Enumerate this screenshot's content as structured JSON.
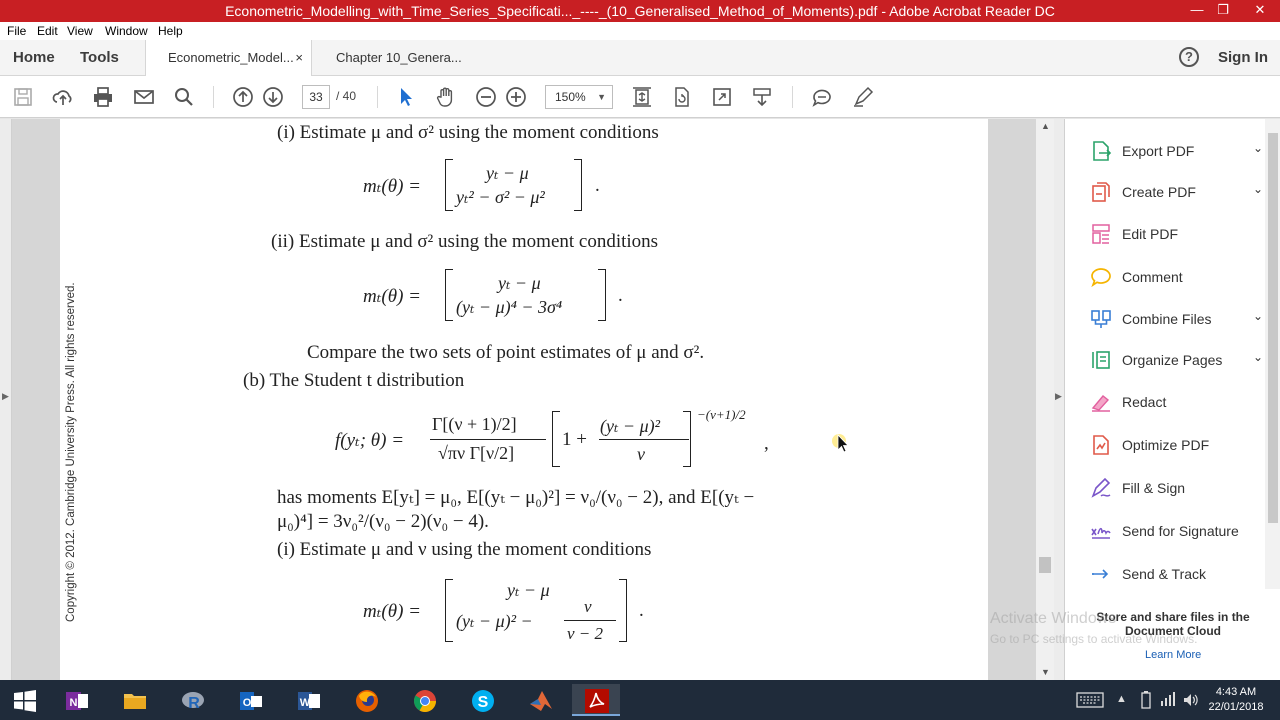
{
  "window": {
    "title": "Econometric_Modelling_with_Time_Series_Specificati..._----_(10_Generalised_Method_of_Moments).pdf - Adobe Acrobat Reader DC",
    "minimize": "—",
    "maximize": "❐",
    "close": "✕"
  },
  "menu": [
    "File",
    "Edit",
    "View",
    "Window",
    "Help"
  ],
  "nav": {
    "home": "Home",
    "tools": "Tools",
    "sign_in": "Sign In",
    "help": "?"
  },
  "tabs": [
    {
      "label": "Econometric_Model...",
      "close": "×"
    },
    {
      "label": "Chapter 10_Genera..."
    }
  ],
  "toolbar": {
    "page_current": "33",
    "page_total": "/  40",
    "zoom": "150%",
    "zoom_caret": "▼"
  },
  "document": {
    "copyright": "Copyright © 2012. Cambridge University Press. All rights reserved.",
    "lines": {
      "l1": "(i)  Estimate μ and σ² using the moment conditions",
      "eq1_lhs": "mₜ(θ) =",
      "eq1_top": "yₜ − μ",
      "eq1_bot": "yₜ² − σ² − μ²",
      "eq1_end": ".",
      "l2": "(ii)  Estimate μ and σ² using the moment conditions",
      "eq2_lhs": "mₜ(θ) =",
      "eq2_top": "yₜ − μ",
      "eq2_bot": "(yₜ − μ)⁴ − 3σ⁴",
      "eq2_end": ".",
      "l3": "Compare the two sets of point estimates of μ and σ².",
      "l4": "(b)  The Student t distribution",
      "eq3_lhs": "f(yₜ; θ) =",
      "eq3_num": "Γ[(ν + 1)/2]",
      "eq3_den": "√πν Γ[ν/2]",
      "eq3_one": "1 +",
      "eq3_inner_num": "(yₜ − μ)²",
      "eq3_inner_den": "ν",
      "eq3_exp": "−(ν+1)/2",
      "eq3_end": ",",
      "l5": "has moments E[yₜ] = μ₀, E[(yₜ − μ₀)²] = ν₀/(ν₀ − 2), and E[(yₜ −",
      "l6": "μ₀)⁴] = 3ν₀²/(ν₀ − 2)(ν₀ − 4).",
      "l7": "(i)  Estimate μ and ν using the moment conditions",
      "eq4_lhs": "mₜ(θ) =",
      "eq4_top": "yₜ − μ",
      "eq4_bot_a": "(yₜ − μ)² −",
      "eq4_bot_num": "ν",
      "eq4_bot_den": "ν − 2",
      "eq4_end": "."
    }
  },
  "right_panel": {
    "items": [
      {
        "label": "Export PDF",
        "chevron": "⌄",
        "color": "#2ba36a"
      },
      {
        "label": "Create PDF",
        "chevron": "⌄",
        "color": "#e05a4a"
      },
      {
        "label": "Edit PDF",
        "color": "#e2609f"
      },
      {
        "label": "Comment",
        "color": "#f5b400"
      },
      {
        "label": "Combine Files",
        "chevron": "⌄",
        "color": "#3a7fd5"
      },
      {
        "label": "Organize Pages",
        "chevron": "⌄",
        "color": "#2ba36a"
      },
      {
        "label": "Redact",
        "color": "#e2609f"
      },
      {
        "label": "Optimize PDF",
        "color": "#e05a4a"
      },
      {
        "label": "Fill & Sign",
        "color": "#7a56c9"
      },
      {
        "label": "Send for Signature",
        "color": "#7a56c9"
      },
      {
        "label": "Send & Track",
        "color": "#3a7fd5"
      }
    ],
    "store_text": "Store and share files in the Document Cloud",
    "learn_more": "Learn More"
  },
  "watermark": {
    "line1": "Activate Windows",
    "line2": "Go to PC settings to activate Windows."
  },
  "taskbar": {
    "time": "4:43 AM",
    "date": "22/01/2018"
  }
}
